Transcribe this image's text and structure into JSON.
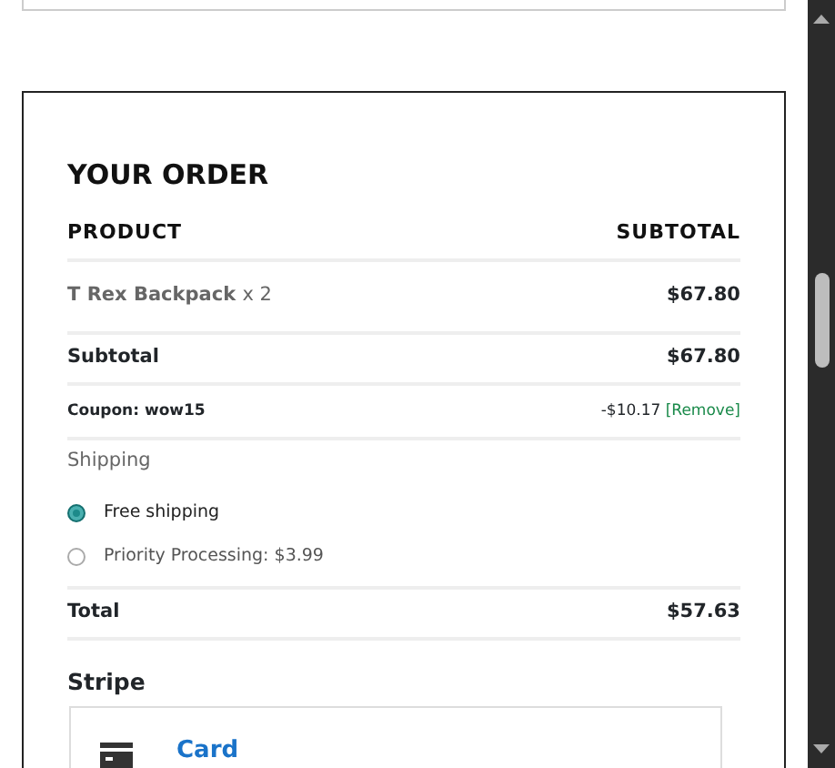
{
  "order": {
    "title": "YOUR ORDER",
    "columns": [
      "PRODUCT",
      "SUBTOTAL"
    ],
    "items": [
      {
        "name": "T Rex Backpack",
        "quantity": "x 2",
        "subtotal": "$67.80"
      }
    ],
    "subtotal": {
      "label": "Subtotal",
      "value": "$67.80"
    },
    "coupon": {
      "label": "Coupon: wow15",
      "amount": "-$10.17",
      "remove": "[Remove]"
    },
    "shipping": {
      "label": "Shipping",
      "options": [
        {
          "label": "Free shipping",
          "selected": true
        },
        {
          "label": "Priority Processing: $3.99",
          "selected": false
        }
      ]
    },
    "total": {
      "label": "Total",
      "value": "$57.63"
    }
  },
  "payment": {
    "title": "Stripe",
    "method": "Card"
  }
}
